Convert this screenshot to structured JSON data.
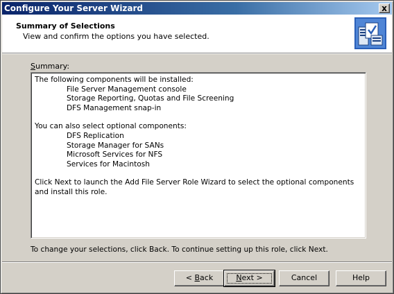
{
  "window": {
    "title": "Configure Your Server Wizard",
    "close_label": "x"
  },
  "header": {
    "title": "Summary of Selections",
    "subtitle": "View and confirm the options you have selected.",
    "icon": "server-wizard-icon"
  },
  "summary": {
    "label_underlined": "S",
    "label_rest": "ummary:",
    "install_heading": "The following components will be installed:",
    "install_items": [
      "File Server Management console",
      "Storage Reporting, Quotas and File Screening",
      "DFS Management snap-in"
    ],
    "optional_heading": "You can also select optional components:",
    "optional_items": [
      "DFS Replication",
      "Storage Manager for SANs",
      "Microsoft Services for NFS",
      "Services for Macintosh"
    ],
    "closing_text": "Click Next to launch the Add File Server Role Wizard to select the optional components and install this role."
  },
  "instructions": "To change your selections, click Back. To continue setting up this role, click Next.",
  "buttons": {
    "back_prefix": "< ",
    "back_underlined": "B",
    "back_rest": "ack",
    "next_underlined": "N",
    "next_rest": "ext >",
    "cancel": "Cancel",
    "help": "Help"
  },
  "colors": {
    "dialog_face": "#d4d0c8",
    "title_gradient_start": "#0a246a",
    "title_gradient_end": "#a6caf0"
  }
}
